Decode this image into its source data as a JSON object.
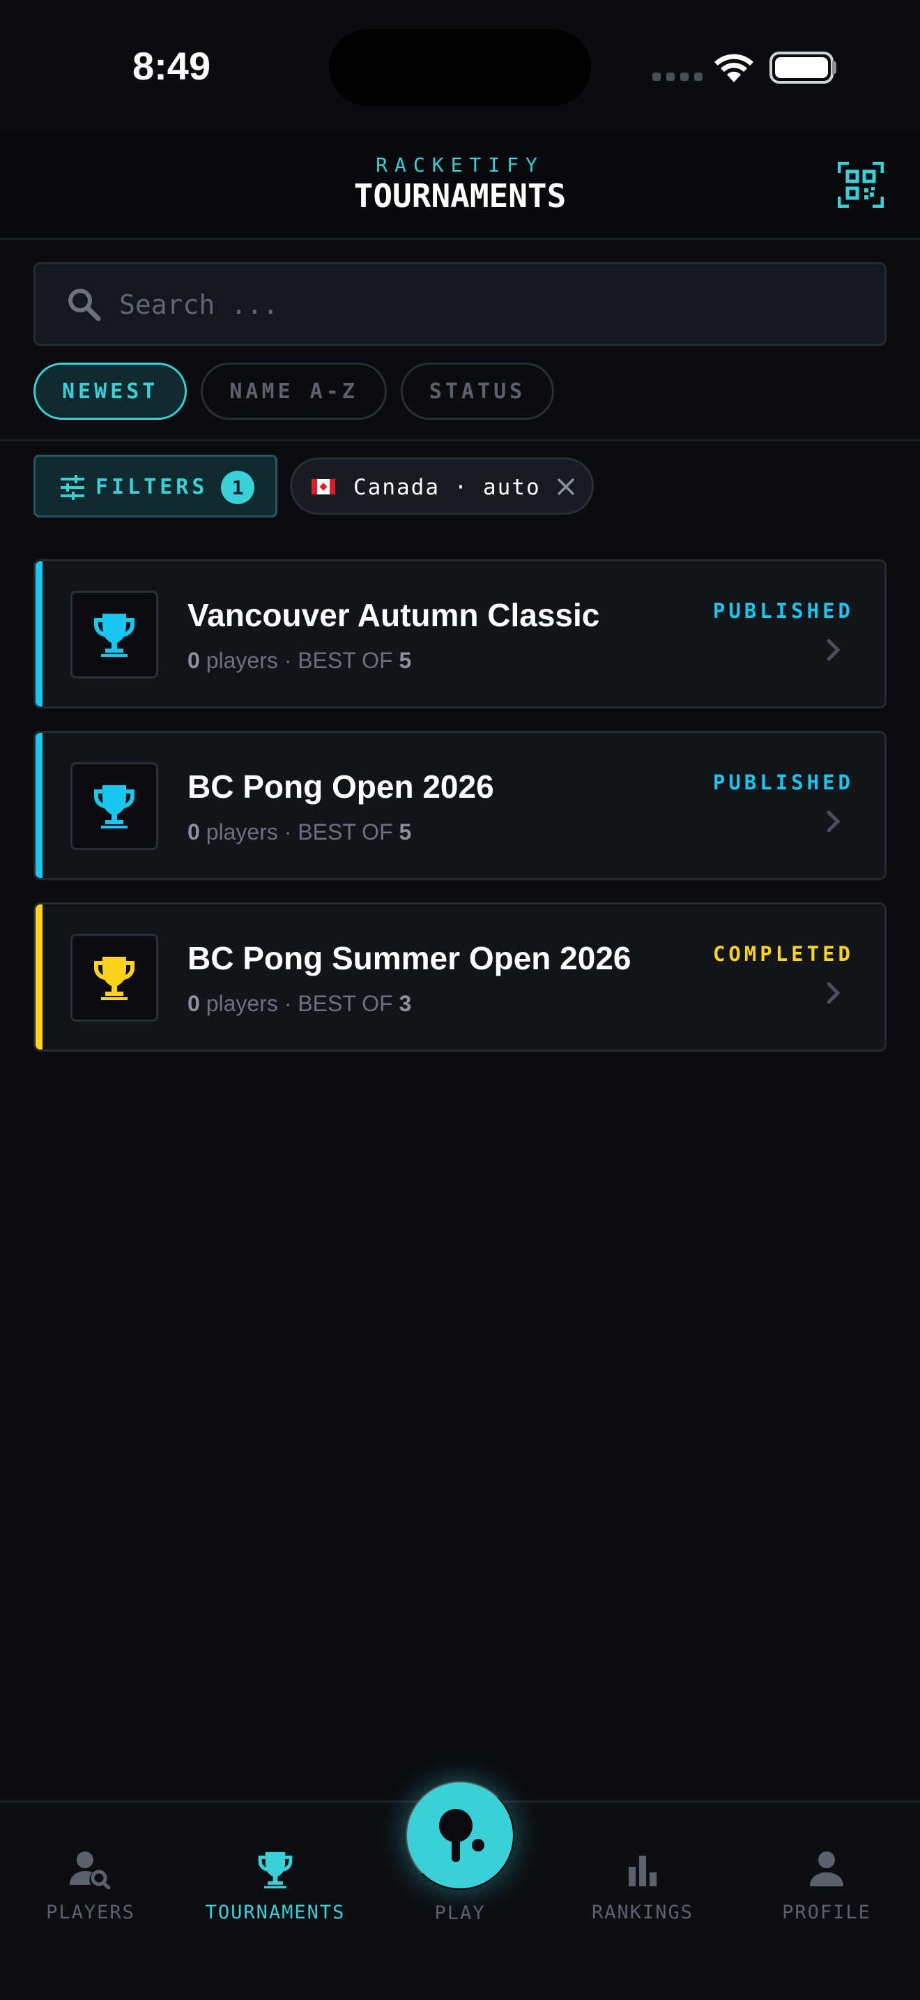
{
  "status_bar": {
    "time": "8:49"
  },
  "header": {
    "brand": "RACKETIFY",
    "title": "TOURNAMENTS"
  },
  "search": {
    "placeholder": "Search ..."
  },
  "sort_options": [
    {
      "label": "NEWEST",
      "active": true
    },
    {
      "label": "NAME A-Z",
      "active": false
    },
    {
      "label": "STATUS",
      "active": false
    }
  ],
  "filters": {
    "label": "FILTERS",
    "count": "1"
  },
  "country_filter": {
    "label": "Canada · auto"
  },
  "colors": {
    "accent": "#3ad0d8",
    "published": "#18c6ee",
    "completed": "#ffd21f",
    "background": "#0a0c10"
  },
  "tournaments": [
    {
      "name": "Vancouver Autumn Classic",
      "players": "0",
      "players_label": "players",
      "best_of_label": "BEST OF",
      "best_of": "5",
      "status": "PUBLISHED",
      "color": "#18c6ee"
    },
    {
      "name": "BC Pong Open 2026",
      "players": "0",
      "players_label": "players",
      "best_of_label": "BEST OF",
      "best_of": "5",
      "status": "PUBLISHED",
      "color": "#18c6ee"
    },
    {
      "name": "BC Pong Summer Open 2026",
      "players": "0",
      "players_label": "players",
      "best_of_label": "BEST OF",
      "best_of": "3",
      "status": "COMPLETED",
      "color": "#ffd21f"
    }
  ],
  "nav": {
    "players": "PLAYERS",
    "tournaments": "TOURNAMENTS",
    "play": "PLAY",
    "rankings": "RANKINGS",
    "profile": "PROFILE",
    "active": "tournaments"
  }
}
